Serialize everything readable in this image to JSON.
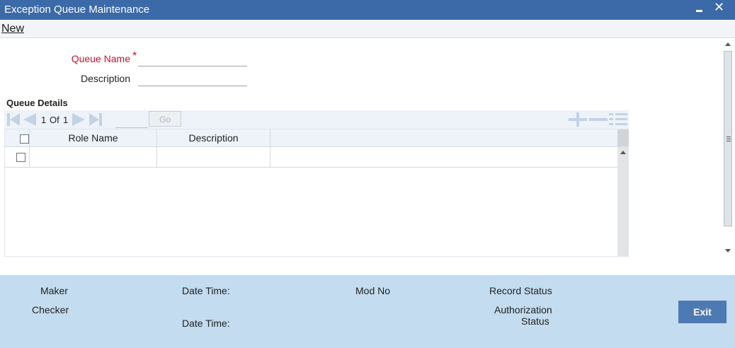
{
  "window": {
    "title": "Exception Queue Maintenance",
    "minimize_icon": "minimize-icon",
    "close_icon": "close-icon",
    "close_glyph": "✕"
  },
  "menubar": {
    "new_label": "New"
  },
  "form": {
    "queue_name_label": "Queue Name",
    "required_marker": "*",
    "queue_name_value": "",
    "description_label": "Description",
    "description_value": ""
  },
  "queue_details": {
    "section_title": "Queue Details",
    "pager": {
      "current_page": "1",
      "of_label": "Of",
      "total_pages": "1",
      "page_input_value": "",
      "go_label": "Go"
    },
    "columns": [
      "Role Name",
      "Description"
    ],
    "rows": [
      {
        "role_name": "",
        "description": ""
      }
    ]
  },
  "footer": {
    "maker_label": "Maker",
    "checker_label": "Checker",
    "date_time_label_1": "Date Time:",
    "date_time_label_2": "Date Time:",
    "mod_no_label": "Mod No",
    "record_status_label": "Record Status",
    "authorization_label_line1": "Authorization",
    "authorization_label_line2": "Status",
    "exit_label": "Exit"
  },
  "colors": {
    "title_bar": "#3c6aa8",
    "footer": "#c3dcef",
    "required": "#c8102e",
    "exit_button": "#4e7ab3"
  }
}
